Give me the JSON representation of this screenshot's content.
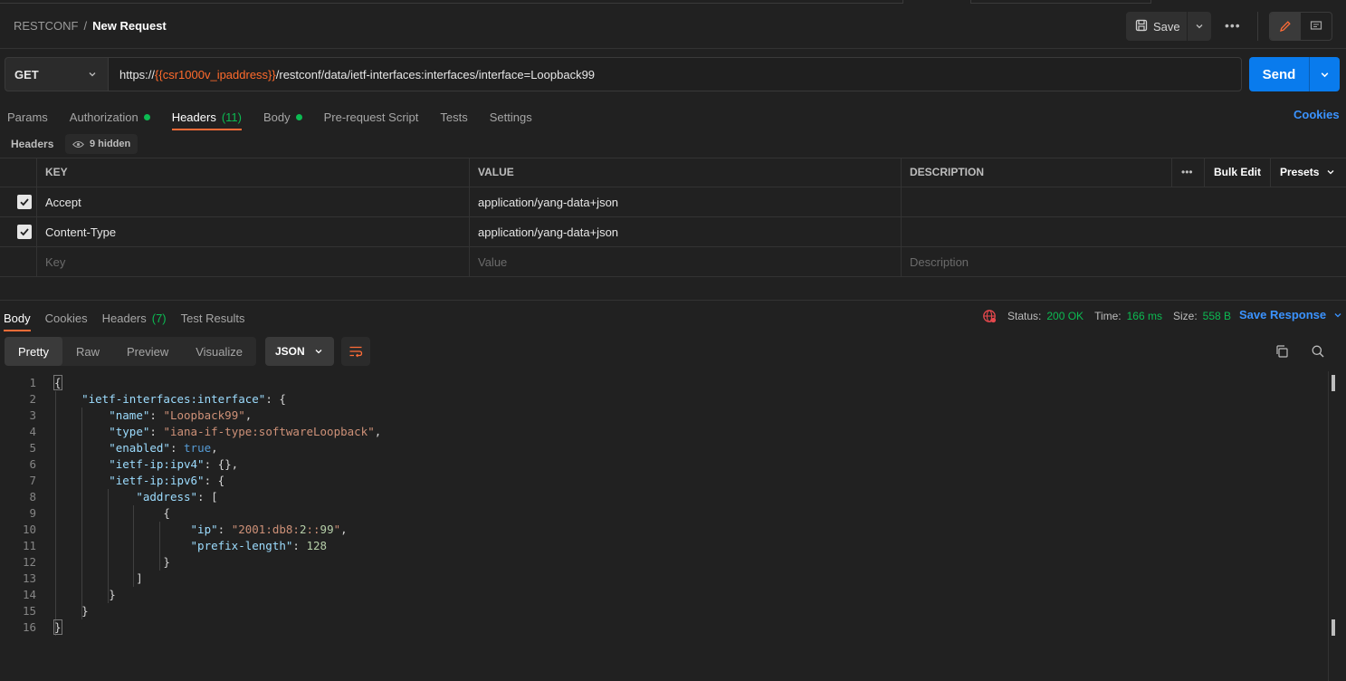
{
  "breadcrumb": {
    "collection": "RESTCONF",
    "separator": "/",
    "request": "New Request"
  },
  "toolbar": {
    "save_label": "Save",
    "more_label": "•••"
  },
  "request": {
    "method": "GET",
    "url_prefix": "https://",
    "url_variable": "{{csr1000v_ipaddress}}",
    "url_suffix": "/restconf/data/ietf-interfaces:interfaces/interface=Loopback99",
    "send_label": "Send"
  },
  "request_tabs": [
    {
      "label": "Params"
    },
    {
      "label": "Authorization"
    },
    {
      "label": "Headers",
      "count": "(11)"
    },
    {
      "label": "Body"
    },
    {
      "label": "Pre-request Script"
    },
    {
      "label": "Tests"
    },
    {
      "label": "Settings"
    }
  ],
  "cookies_link": "Cookies",
  "headers_section": {
    "title": "Headers",
    "hidden_label": "9 hidden"
  },
  "headers_table": {
    "columns": {
      "key": "KEY",
      "value": "VALUE",
      "description": "DESCRIPTION"
    },
    "more_label": "•••",
    "bulk_edit": "Bulk Edit",
    "presets": "Presets",
    "rows": [
      {
        "checked": true,
        "key": "Accept",
        "value": "application/yang-data+json",
        "description": ""
      },
      {
        "checked": true,
        "key": "Content-Type",
        "value": "application/yang-data+json",
        "description": ""
      }
    ],
    "placeholders": {
      "key": "Key",
      "value": "Value",
      "description": "Description"
    }
  },
  "response_tabs": [
    {
      "label": "Body"
    },
    {
      "label": "Cookies"
    },
    {
      "label": "Headers",
      "count": "(7)"
    },
    {
      "label": "Test Results"
    }
  ],
  "response_status": {
    "status_label": "Status:",
    "status_value": "200 OK",
    "time_label": "Time:",
    "time_value": "166 ms",
    "size_label": "Size:",
    "size_value": "558 B",
    "save_response": "Save Response"
  },
  "view_modes": [
    "Pretty",
    "Raw",
    "Preview",
    "Visualize"
  ],
  "format": "JSON",
  "code_lines": [
    {
      "n": "1",
      "text": "{"
    },
    {
      "n": "2",
      "text": "    \"ietf-interfaces:interface\": {"
    },
    {
      "n": "3",
      "text": "        \"name\": \"Loopback99\","
    },
    {
      "n": "4",
      "text": "        \"type\": \"iana-if-type:softwareLoopback\","
    },
    {
      "n": "5",
      "text": "        \"enabled\": true,"
    },
    {
      "n": "6",
      "text": "        \"ietf-ip:ipv4\": {},"
    },
    {
      "n": "7",
      "text": "        \"ietf-ip:ipv6\": {"
    },
    {
      "n": "8",
      "text": "            \"address\": ["
    },
    {
      "n": "9",
      "text": "                {"
    },
    {
      "n": "10",
      "text": "                    \"ip\": \"2001:db8:2::99\","
    },
    {
      "n": "11",
      "text": "                    \"prefix-length\": 128"
    },
    {
      "n": "12",
      "text": "                }"
    },
    {
      "n": "13",
      "text": "            ]"
    },
    {
      "n": "14",
      "text": "        }"
    },
    {
      "n": "15",
      "text": "    }"
    },
    {
      "n": "16",
      "text": "}"
    }
  ],
  "colors": {
    "accent_orange": "#ff6c37",
    "send_blue": "#097bed",
    "link_blue": "#3b93ff",
    "status_green": "#0cbb52",
    "background": "#212121"
  }
}
